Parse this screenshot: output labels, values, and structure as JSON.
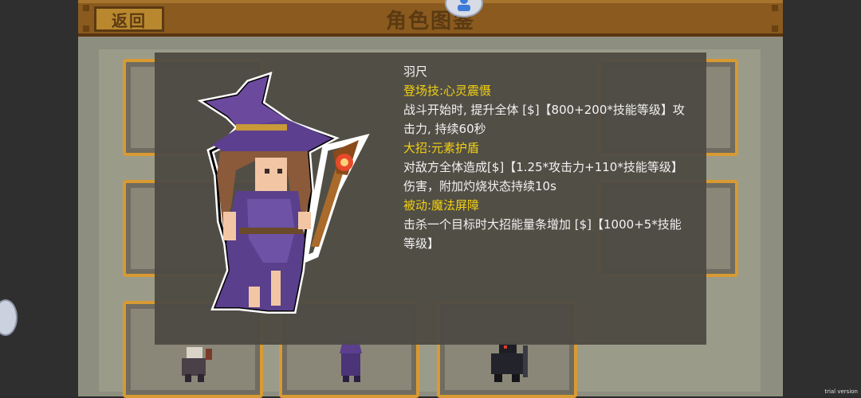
{
  "header": {
    "title": "角色图鉴",
    "back_label": "返回"
  },
  "character": {
    "name": "羽尺",
    "skills": [
      {
        "title": "登场技:心灵震慑",
        "desc": "战斗开始时, 提升全体 [$]【800+200*技能等级】攻击力, 持续60秒"
      },
      {
        "title": "大招:元素护盾",
        "desc": "对敌方全体造成[$]【1.25*攻击力+110*技能等级】伤害，附加灼烧状态持续10s"
      },
      {
        "title": "被动:魔法屏障",
        "desc": "击杀一个目标时大招能量条增加 [$]【1000+5*技能等级】"
      }
    ]
  },
  "watermark": "trial version",
  "colors": {
    "highlight": "#f3d10f",
    "frame_wood": "#8a5a1f",
    "card_border": "#d89a32"
  },
  "icons": {
    "back": "back-button",
    "top_avatar": "avatar-icon",
    "edge_avatar": "avatar-icon",
    "portrait": "witch-sprite"
  }
}
